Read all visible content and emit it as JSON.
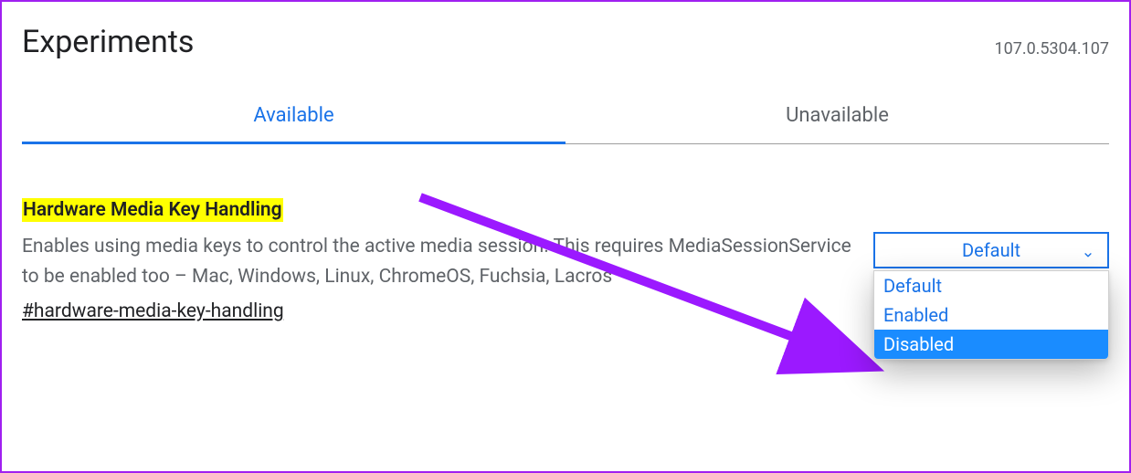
{
  "header": {
    "title": "Experiments",
    "version": "107.0.5304.107"
  },
  "tabs": {
    "available": "Available",
    "unavailable": "Unavailable"
  },
  "flag": {
    "title": "Hardware Media Key Handling",
    "description": "Enables using media keys to control the active media session. This requires MediaSessionService to be enabled too – Mac, Windows, Linux, ChromeOS, Fuchsia, Lacros",
    "anchor": "#hardware-media-key-handling"
  },
  "select": {
    "value": "Default",
    "options": [
      "Default",
      "Enabled",
      "Disabled"
    ],
    "highlighted": "Disabled"
  }
}
